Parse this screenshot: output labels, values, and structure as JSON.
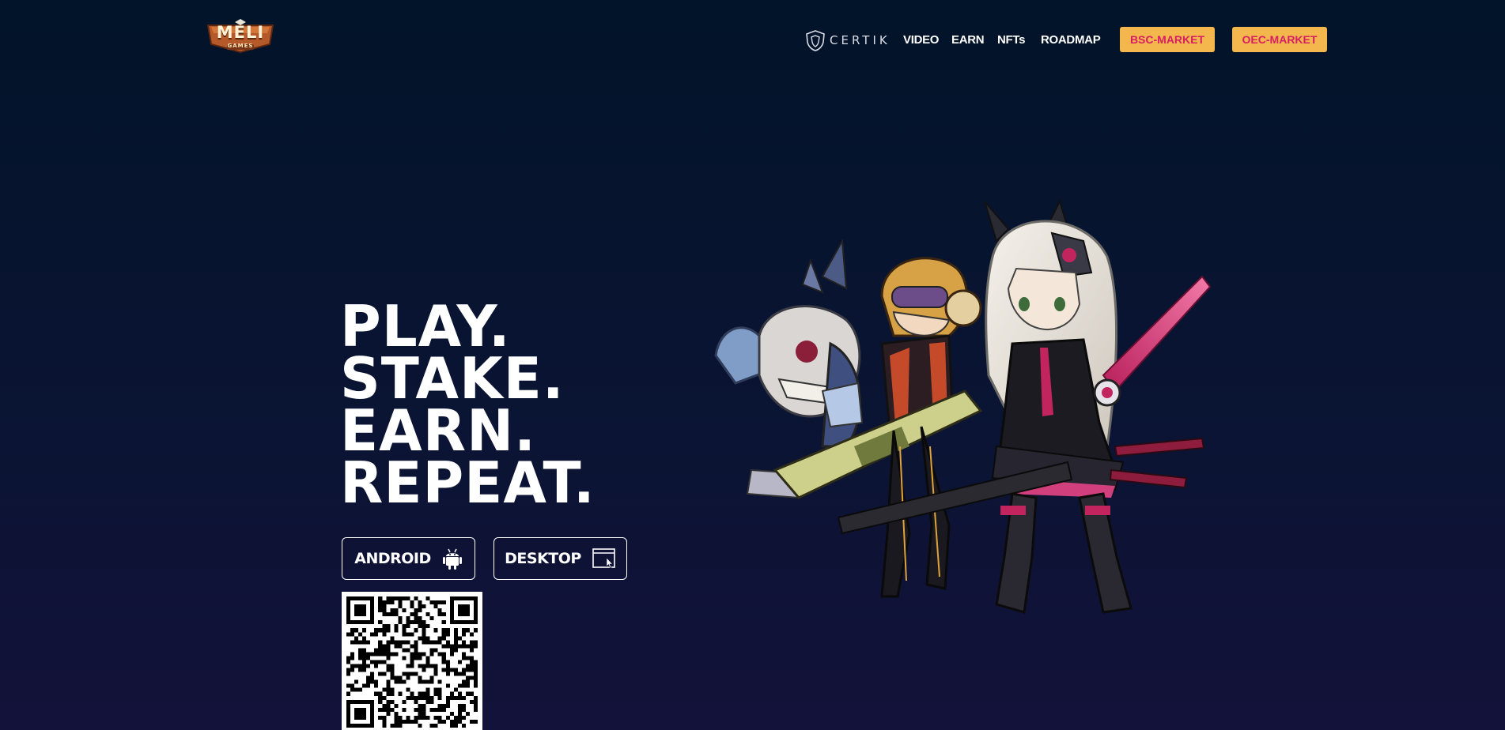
{
  "header": {
    "logo": {
      "text": "MELI",
      "subtext": "GAMES",
      "icon": "meli-games-logo"
    },
    "certik": {
      "label": "CERTIK",
      "icon": "certik-shield-icon"
    },
    "nav": [
      {
        "label": "VIDEO"
      },
      {
        "label": "EARN"
      },
      {
        "label": "NFTs"
      },
      {
        "label": "ROADMAP"
      }
    ],
    "buttons": {
      "bsc_market": "BSC-MARKET",
      "oec_market": "OEC-MARKET"
    }
  },
  "hero": {
    "lines": [
      "PLAY.",
      "STAKE.",
      "EARN.",
      "REPEAT."
    ],
    "downloads": {
      "android": {
        "label": "ANDROID",
        "icon": "android-icon"
      },
      "desktop": {
        "label": "DESKTOP",
        "icon": "desktop-window-icon"
      }
    },
    "qr_icon": "qr-code"
  },
  "colors": {
    "background_top": "#021429",
    "background_bottom": "#13123a",
    "market_button_bg": "#f3b74d",
    "market_button_text": "#d81e63"
  }
}
